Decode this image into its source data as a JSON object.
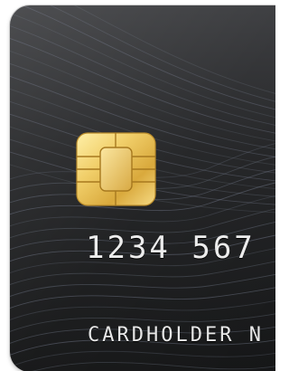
{
  "card": {
    "number_visible": "1234 567",
    "cardholder_visible": "CARDHOLDER N",
    "chip_icon": "emv-chip-icon",
    "colors": {
      "card_body": "#1e1f21",
      "chip_gold": "#e8c25a",
      "text": "#ececec",
      "wave_lines": "#8a93a8"
    }
  }
}
